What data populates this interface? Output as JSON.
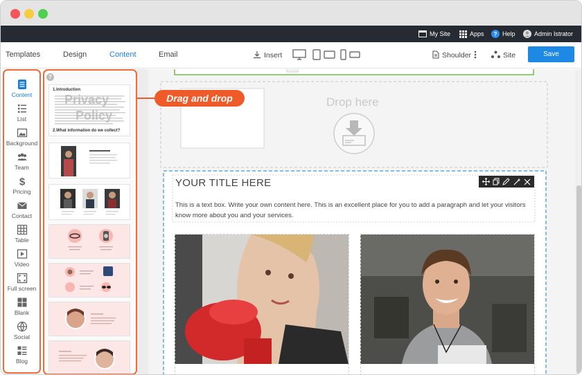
{
  "topbar": {
    "my_site": "My Site",
    "apps": "Apps",
    "help": "Help",
    "user": "Admin Istrator"
  },
  "toolbar": {
    "tabs": [
      {
        "label": "Templates"
      },
      {
        "label": "Design"
      },
      {
        "label": "Content"
      },
      {
        "label": "Email"
      }
    ],
    "insert": "Insert",
    "shoulder": "Shoulder",
    "site": "Site",
    "save": "Save"
  },
  "sidebar": {
    "items": [
      {
        "label": "Content",
        "icon": "content-icon"
      },
      {
        "label": "List",
        "icon": "list-icon"
      },
      {
        "label": "Background",
        "icon": "background-icon"
      },
      {
        "label": "Team",
        "icon": "team-icon"
      },
      {
        "label": "Pricing",
        "icon": "dollar-icon"
      },
      {
        "label": "Contact",
        "icon": "mail-icon"
      },
      {
        "label": "Table",
        "icon": "table-icon"
      },
      {
        "label": "Video",
        "icon": "video-icon"
      },
      {
        "label": "Full screen",
        "icon": "fullscreen-icon"
      },
      {
        "label": "Blank",
        "icon": "blank-icon"
      },
      {
        "label": "Social",
        "icon": "social-icon"
      },
      {
        "label": "Blog",
        "icon": "blog-icon"
      }
    ]
  },
  "templates": {
    "privacy": {
      "heading": "1.Introduction",
      "watermark_line1": "Privacy",
      "watermark_line2": "Policy",
      "heading2": "2.What information do we collect?"
    }
  },
  "callout": "Drag and drop",
  "canvas": {
    "drop_here": "Drop here",
    "title": "YOUR TITLE HERE",
    "body": "This is a text box. Write your own content here. This is an excellent place for you to add a paragraph and let your visitors know more about you and your services."
  },
  "colors": {
    "accent": "#1e88e5",
    "orange": "#ef5b28",
    "topbar": "#262a33"
  }
}
